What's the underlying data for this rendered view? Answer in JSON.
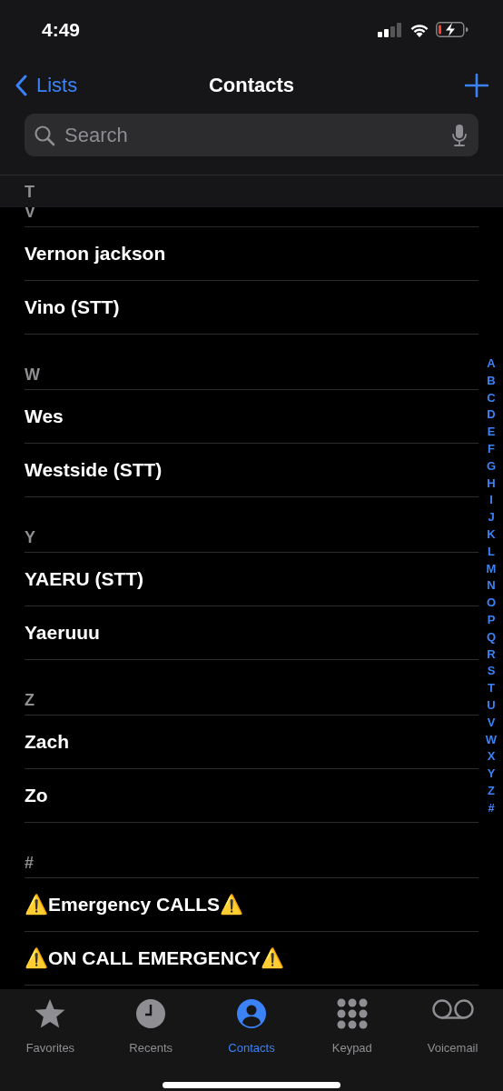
{
  "status_bar": {
    "time": "4:49"
  },
  "nav": {
    "back": "Lists",
    "title": "Contacts"
  },
  "search": {
    "placeholder": "Search"
  },
  "sticky_header": "T",
  "sections": [
    {
      "letter": "V",
      "contacts": [
        {
          "name": "Vernon jackson"
        },
        {
          "name": "Vino (STT)"
        }
      ]
    },
    {
      "letter": "W",
      "contacts": [
        {
          "name": "Wes"
        },
        {
          "name": "Westside (STT)"
        }
      ]
    },
    {
      "letter": "Y",
      "contacts": [
        {
          "name": "YAERU (STT)"
        },
        {
          "name": "Yaeruuu"
        }
      ]
    },
    {
      "letter": "Z",
      "contacts": [
        {
          "name": "Zach"
        },
        {
          "name": "Zo"
        }
      ]
    },
    {
      "letter": "#",
      "contacts": [
        {
          "name": "⚠️Emergency CALLS⚠️"
        },
        {
          "name": "⚠️ON CALL EMERGENCY⚠️"
        }
      ]
    }
  ],
  "index": [
    "A",
    "B",
    "C",
    "D",
    "E",
    "F",
    "G",
    "H",
    "I",
    "J",
    "K",
    "L",
    "M",
    "N",
    "O",
    "P",
    "Q",
    "R",
    "S",
    "T",
    "U",
    "V",
    "W",
    "X",
    "Y",
    "Z",
    "#"
  ],
  "tabs": [
    {
      "kind": "favorites",
      "label": "Favorites",
      "selected": false
    },
    {
      "kind": "recents",
      "label": "Recents",
      "selected": false
    },
    {
      "kind": "contacts",
      "label": "Contacts",
      "selected": true
    },
    {
      "kind": "keypad",
      "label": "Keypad",
      "selected": false
    },
    {
      "kind": "voicemail",
      "label": "Voicemail",
      "selected": false
    }
  ]
}
